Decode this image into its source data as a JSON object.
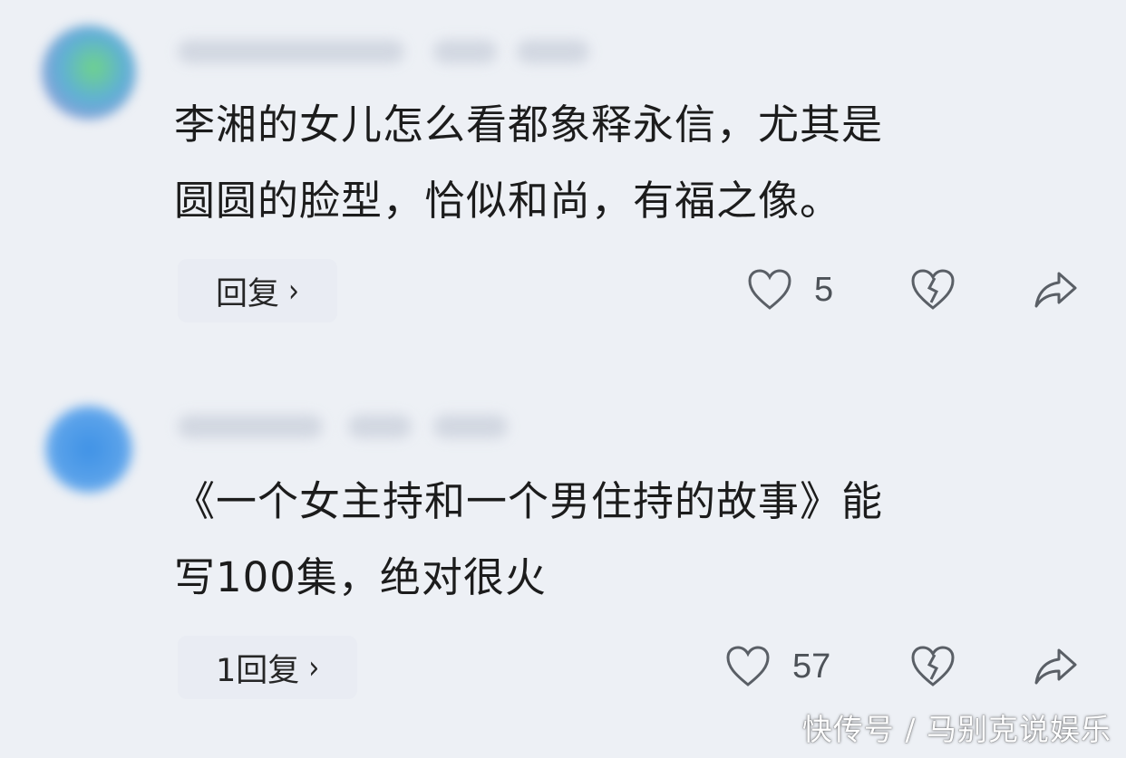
{
  "comments": [
    {
      "text": "李湘的女儿怎么看都象释永信，尤其是\n圆圆的脸型，恰似和尚，有福之像。",
      "reply_label": "回复",
      "likes": "5"
    },
    {
      "text": "《一个女主持和一个男住持的故事》能\n写100集，绝对很火",
      "reply_label": "1回复",
      "likes": "57"
    }
  ],
  "icons": {
    "like": "heart-outline-icon",
    "dislike": "broken-heart-icon",
    "share": "share-arrow-icon",
    "reply_chevron": "chevron-right-icon"
  },
  "watermark": "快传号 / 马别克说娱乐",
  "colors": {
    "background": "#edf0f5",
    "text": "#1c1c1c",
    "icon": "#5a5f66"
  }
}
